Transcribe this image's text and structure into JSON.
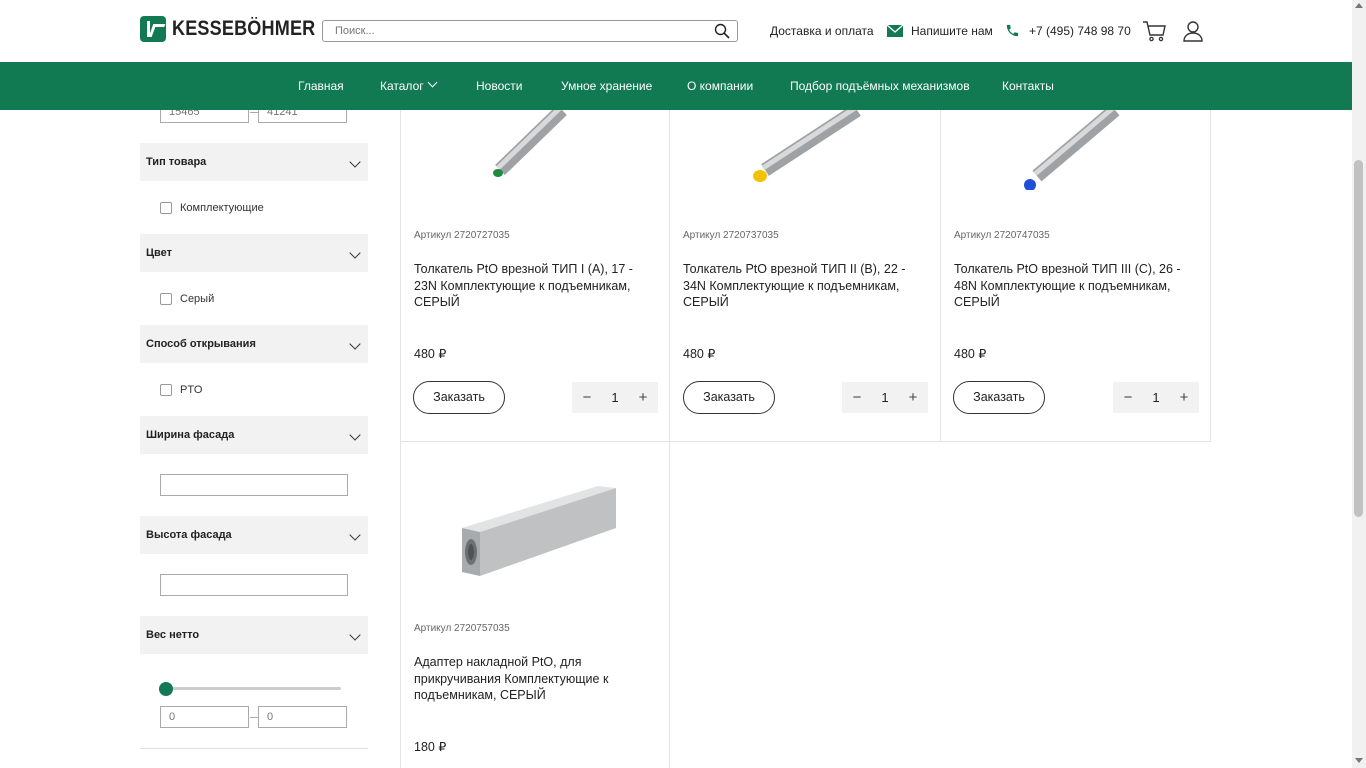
{
  "header": {
    "logo_text": "KESSEBÖHMER",
    "search_placeholder": "Поиск...",
    "delivery": "Доставка и оплата",
    "write_us": "Напишите нам",
    "phone": "+7 (495) 748 98 70"
  },
  "nav": {
    "items": [
      "Главная",
      "Каталог",
      "Новости",
      "Умное хранение",
      "О компании",
      "Подбор подъёмных механизмов",
      "Контакты"
    ]
  },
  "sidebar": {
    "range_from_placeholder": "15465",
    "range_to_placeholder": "41241",
    "filters": [
      {
        "title": "Тип товара",
        "option": "Комплектующие"
      },
      {
        "title": "Цвет",
        "option": "Серый"
      },
      {
        "title": "Способ открывания",
        "option": "PTO"
      },
      {
        "title": "Ширина фасада"
      },
      {
        "title": "Высота фасада"
      },
      {
        "title": "Вес нетто"
      }
    ],
    "weight_from_placeholder": "0",
    "weight_to_placeholder": "0"
  },
  "products": [
    {
      "sku": "Артикул 2720727035",
      "name": "Толкатель PtO врезной ТИП I (А), 17 - 23N Комплектующие к подъемникам, СЕРЫЙ",
      "price": "480 ₽",
      "order": "Заказать",
      "qty": "1",
      "tip_color": "#1f8a3c"
    },
    {
      "sku": "Артикул 2720737035",
      "name": "Толкатель PtO врезной ТИП II (B), 22 - 34N Комплектующие к подъемникам, СЕРЫЙ",
      "price": "480 ₽",
      "order": "Заказать",
      "qty": "1",
      "tip_color": "#f2c200"
    },
    {
      "sku": "Артикул 2720747035",
      "name": "Толкатель PtO врезной ТИП III (C), 26 - 48N Комплектующие к подъемникам, СЕРЫЙ",
      "price": "480 ₽",
      "order": "Заказать",
      "qty": "1",
      "tip_color": "#1f4ed8"
    },
    {
      "sku": "Артикул 2720757035",
      "name": "Адаптер накладной PtO, для прикручивания Комплектующие к подъемникам, СЕРЫЙ",
      "price": "180 ₽"
    }
  ],
  "colors": {
    "brand_green": "#127a52",
    "filter_bg": "#f2f2f2"
  }
}
